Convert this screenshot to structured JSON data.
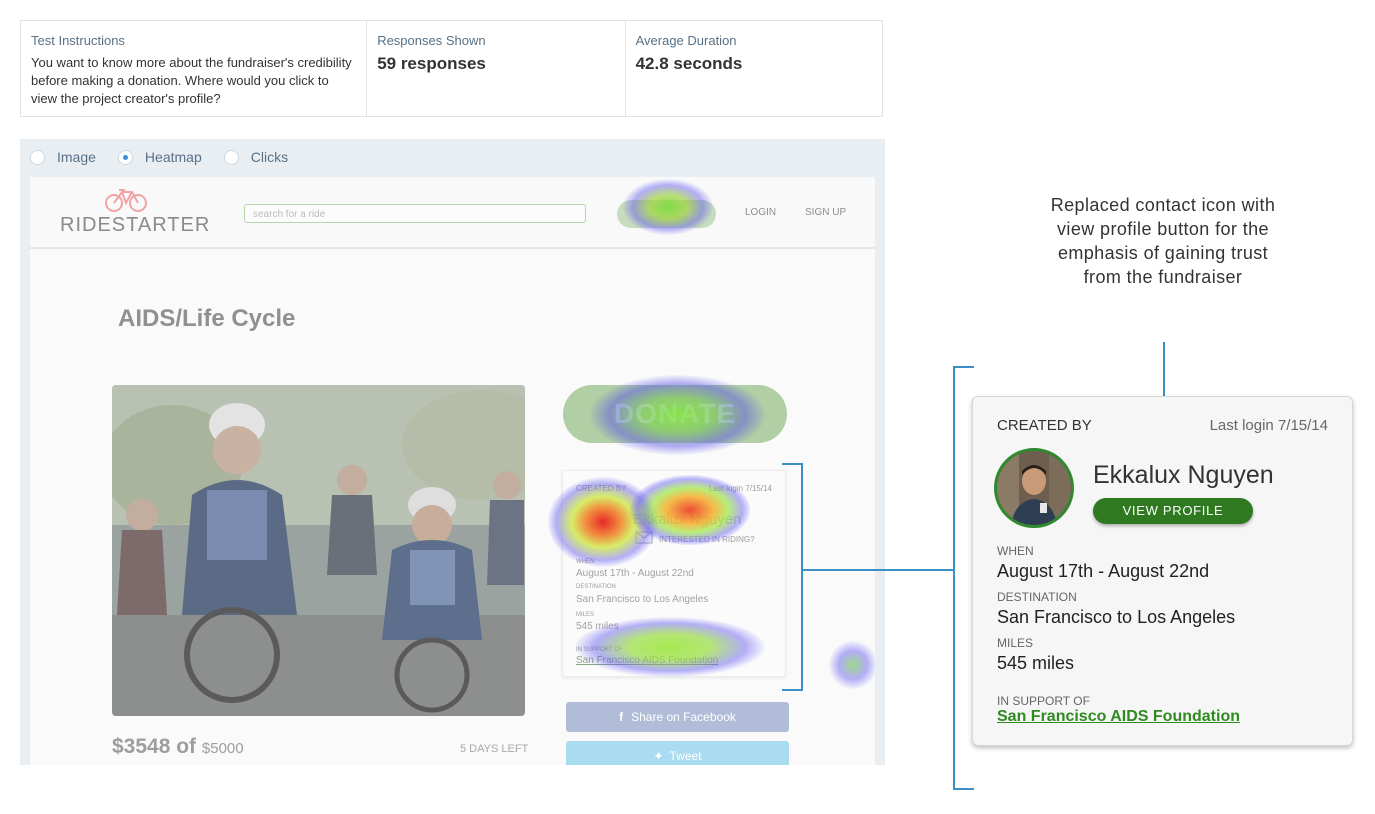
{
  "stats": {
    "instructions": {
      "label": "Test Instructions",
      "text": "You want to know more about the fundraiser's credibility before making a donation. Where would you click to view the project creator's profile?"
    },
    "responses": {
      "label": "Responses Shown",
      "value": "59 responses"
    },
    "duration": {
      "label": "Average Duration",
      "value": "42.8 seconds"
    }
  },
  "view_modes": [
    {
      "label": "Image",
      "selected": false
    },
    {
      "label": "Heatmap",
      "selected": true
    },
    {
      "label": "Clicks",
      "selected": false
    }
  ],
  "site": {
    "logo_text": "RIDESTARTER",
    "search_placeholder": "search for a ride",
    "nav": {
      "discover": "DISCOVER",
      "login": "LOGIN",
      "signup": "SIGN UP"
    },
    "project_title": "AIDS/Life Cycle",
    "donate": "DONATE",
    "mini_card": {
      "created_by": "CREATED BY",
      "last_login": "Last login 7/15/14",
      "name": "Ekkalux Nguyen",
      "interested": "INTERESTED IN RIDING?",
      "when_label": "WHEN",
      "when": "August 17th - August 22nd",
      "destination_label": "DESTINATION",
      "destination": "San Francisco to Los Angeles",
      "miles_label": "MILES",
      "miles": "545 miles",
      "support_label": "IN SUPPORT OF",
      "support": "San Francisco AIDS Foundation"
    },
    "share_facebook": "Share on Facebook",
    "tweet": "Tweet",
    "amount": "$3548 of",
    "goal": "$5000",
    "days_left": "5 DAYS LEFT"
  },
  "annotation": {
    "note": "Replaced contact icon with view profile button for the emphasis of gaining trust from the fundraiser"
  },
  "profile_card": {
    "created_by": "CREATED BY",
    "last_login": "Last login 7/15/14",
    "name": "Ekkalux Nguyen",
    "view_profile": "VIEW PROFILE",
    "when_label": "WHEN",
    "when": "August 17th - August 22nd",
    "destination_label": "DESTINATION",
    "destination": "San Francisco to Los Angeles",
    "miles_label": "MILES",
    "miles": "545 miles",
    "support_label": "IN SUPPORT OF",
    "support": "San Francisco AIDS Foundation"
  },
  "colors": {
    "accent_green": "#2f7a21",
    "annotation_line": "#3b8fc5",
    "radio_selected": "#3b8fd8"
  }
}
